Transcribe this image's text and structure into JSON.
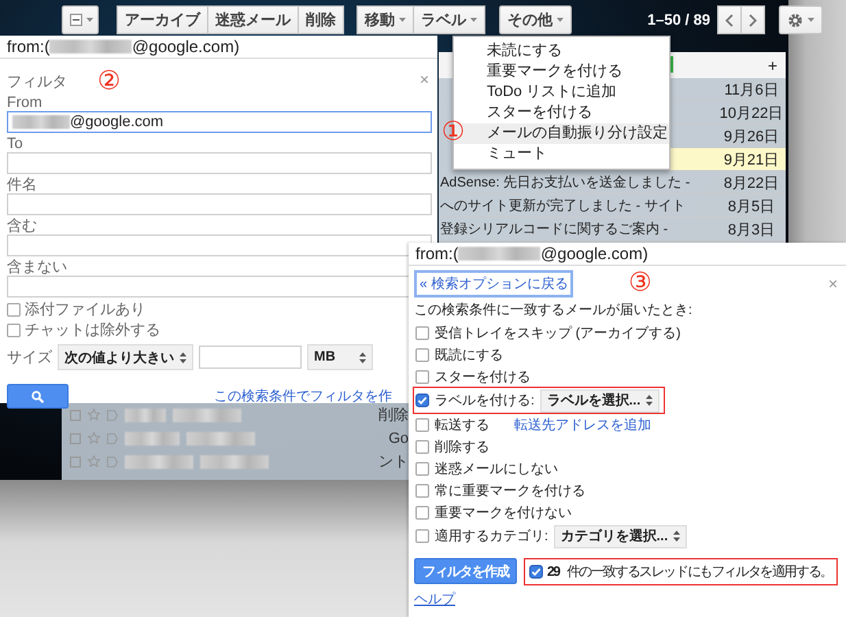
{
  "toolbar": {
    "actions": [
      "アーカイブ",
      "迷惑メール",
      "削除"
    ],
    "move_menus": [
      "移動",
      "ラベル"
    ],
    "more": "その他",
    "range": "1–50 / 89"
  },
  "mail_list": {
    "new_tab": "+",
    "rows": [
      {
        "date": "11月6日",
        "highlighted": false
      },
      {
        "date": "10月22日",
        "highlighted": false
      },
      {
        "date": "9月26日",
        "highlighted": false
      },
      {
        "date": "9月21日",
        "highlighted": true
      },
      {
        "subject": "AdSense: 先日お支払いを送金しました -",
        "date": "8月22日",
        "highlighted": false
      },
      {
        "subject": "へのサイト更新が完了しました - サイト",
        "date": "8月5日",
        "highlighted": false
      },
      {
        "subject": "登録シリアルコードに関するご案内 -",
        "date": "8月3日",
        "highlighted": false
      }
    ]
  },
  "menu": {
    "marker": "①",
    "items": [
      {
        "label": "未読にする",
        "selected": false
      },
      {
        "label": "重要マークを付ける",
        "selected": false
      },
      {
        "label": "ToDo リストに追加",
        "selected": false
      },
      {
        "label": "スターを付ける",
        "selected": false
      },
      {
        "label": "メールの自動振り分け設定",
        "selected": true
      },
      {
        "label": "ミュート",
        "selected": false
      }
    ]
  },
  "filter_panel": {
    "query_prefix": "from:(",
    "query_suffix": "@google.com)",
    "title": "フィルタ",
    "marker": "②",
    "close": "×",
    "fields": [
      {
        "label": "From",
        "value": "@google.com",
        "focused": true
      },
      {
        "label": "To",
        "focused": false
      },
      {
        "label": "件名",
        "focused": false
      },
      {
        "label": "含む",
        "focused": false
      },
      {
        "label": "含まない",
        "focused": false
      }
    ],
    "options": [
      {
        "label": "添付ファイルあり",
        "checked": false
      },
      {
        "label": "チャットは除外する",
        "checked": false
      }
    ],
    "size": {
      "label": "サイズ",
      "comparator": "次の値より大きい",
      "unit": "MB"
    },
    "create_link": "この検索条件でフィルタを作"
  },
  "background_rows": [
    {
      "column_3": "削除"
    },
    {
      "column_3": "Go"
    },
    {
      "column_3": "ント"
    }
  ],
  "action_panel": {
    "query_prefix": "from:(",
    "query_suffix": "@google.com)",
    "back_link": "« 検索オプションに戻る",
    "marker": "③",
    "close": "×",
    "heading": "この検索条件に一致するメールが届いたとき:",
    "actions": [
      {
        "kind": "check",
        "label": "受信トレイをスキップ (アーカイブする)",
        "checked": false
      },
      {
        "kind": "check",
        "label": "既読にする",
        "checked": false
      },
      {
        "kind": "check",
        "label": "スターを付ける",
        "checked": false
      },
      {
        "kind": "select",
        "label": "ラベルを付ける:",
        "checked": true,
        "select": "ラベルを選択...",
        "highlighted": true
      },
      {
        "kind": "link",
        "label": "転送する",
        "checked": false,
        "link": "転送先アドレスを追加"
      },
      {
        "kind": "check",
        "label": "削除する",
        "checked": false
      },
      {
        "kind": "check",
        "label": "迷惑メールにしない",
        "checked": false
      },
      {
        "kind": "check",
        "label": "常に重要マークを付ける",
        "checked": false
      },
      {
        "kind": "check",
        "label": "重要マークを付けない",
        "checked": false
      },
      {
        "kind": "select",
        "label": "適用するカテゴリ:",
        "checked": false,
        "select": "カテゴリを選択...",
        "highlighted": false
      }
    ],
    "create_button": "フィルタを作成",
    "apply_existing": {
      "label": "**29** 件の一致するスレッドにもフィルタを適用する。",
      "checked": true,
      "highlighted": true
    },
    "help": "ヘルプ"
  }
}
